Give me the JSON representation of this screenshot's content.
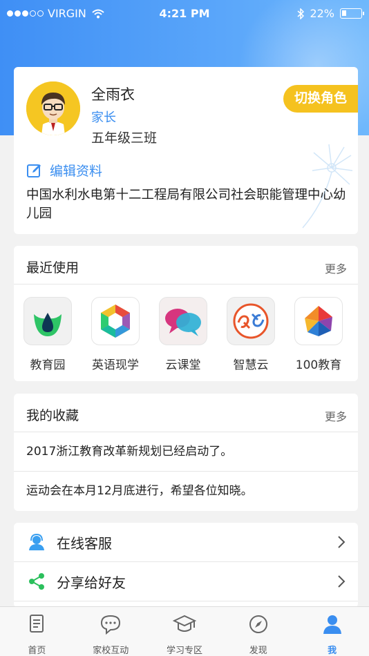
{
  "status_bar": {
    "carrier": "VIRGIN",
    "time": "4:21 PM",
    "battery": "22%",
    "battery_level": 0.22
  },
  "profile": {
    "name": "全雨衣",
    "role": "家长",
    "class": "五年级三班",
    "switch_role_label": "切换角色",
    "edit_label": "编辑资料",
    "school": "中国水利水电第十二工程局有限公司社会职能管理中心幼儿园"
  },
  "recent": {
    "title": "最近使用",
    "more": "更多",
    "apps": [
      {
        "label": "教育园",
        "icon": "drop-leaf-icon"
      },
      {
        "label": "英语现学",
        "icon": "hexagon-icon"
      },
      {
        "label": "云课堂",
        "icon": "chat-bubbles-icon"
      },
      {
        "label": "智慧云",
        "icon": "hands-icon"
      },
      {
        "label": "100教育",
        "icon": "polygon-logo-icon"
      }
    ]
  },
  "favorites": {
    "title": "我的收藏",
    "more": "更多",
    "items": [
      "2017浙江教育改革新规划已经启动了。",
      "运动会在本月12月底进行，希望各位知晓。"
    ]
  },
  "menu": [
    {
      "label": "在线客服",
      "icon": "customer-service-icon"
    },
    {
      "label": "分享给好友",
      "icon": "share-icon"
    }
  ],
  "tabs": [
    {
      "label": "首页",
      "icon": "document-icon",
      "active": false
    },
    {
      "label": "家校互动",
      "icon": "chat-icon",
      "active": false
    },
    {
      "label": "学习专区",
      "icon": "graduation-cap-icon",
      "active": false
    },
    {
      "label": "发现",
      "icon": "compass-icon",
      "active": false
    },
    {
      "label": "我",
      "icon": "person-icon",
      "active": true
    }
  ],
  "colors": {
    "accent": "#3a8ef0",
    "switch_role": "#f5c21f",
    "share_green": "#2bbf5c"
  }
}
